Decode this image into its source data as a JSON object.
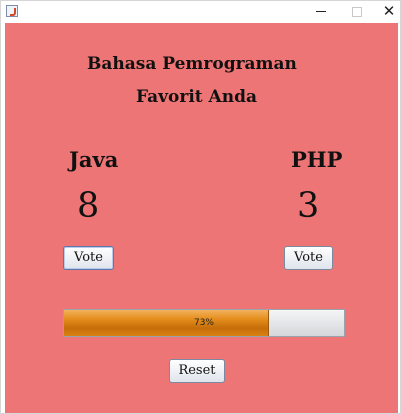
{
  "window": {
    "icon": "java-app-icon",
    "controls": {
      "minimize": "minimize-icon",
      "maximize": "maximize-icon",
      "close": "✕"
    }
  },
  "heading": {
    "line1": "Bahasa Pemrograman",
    "line2": "Favorit Anda"
  },
  "java": {
    "label": "Java",
    "count": "8",
    "vote_label": "Vote"
  },
  "php": {
    "label": "PHP",
    "count": "3",
    "vote_label": "Vote"
  },
  "progress": {
    "value_fraction": 0.73,
    "text": "73%"
  },
  "reset_label": "Reset",
  "colors": {
    "background": "#ee7575",
    "progress_fill": "#e48d1c"
  }
}
